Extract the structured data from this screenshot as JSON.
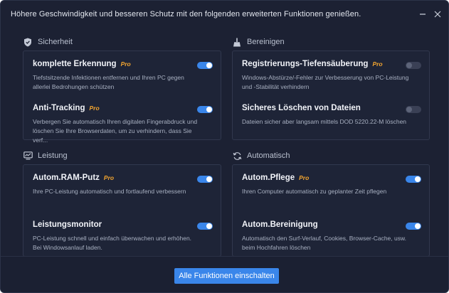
{
  "window": {
    "title": "Höhere Geschwindigkeit und besseren Schutz mit den folgenden erweiterten Funktionen genießen."
  },
  "colors": {
    "accent": "#3a86ea",
    "pro": "#f3a52f",
    "background": "#1c2133"
  },
  "sections": [
    {
      "title": "Sicherheit",
      "icon": "shield-icon",
      "items": [
        {
          "name": "komplette Erkennung",
          "pro": "Pro",
          "enabled": true,
          "description": "Tiefstsitzende Infektionen entfernen und Ihren PC gegen allerlei Bedrohungen schützen"
        },
        {
          "name": "Anti-Tracking",
          "pro": "Pro",
          "enabled": true,
          "description": "Verbergen Sie automatisch Ihren digitalen Fingerabdruck und löschen Sie Ihre Browserdaten, um zu verhindern, dass Sie verf..."
        }
      ]
    },
    {
      "title": "Bereinigen",
      "icon": "broom-icon",
      "items": [
        {
          "name": "Registrierungs-Tiefensäuberung",
          "pro": "Pro",
          "enabled": false,
          "description": "Windows-Abstürze/-Fehler zur Verbesserung von PC-Leistung und -Stabilität verhindern"
        },
        {
          "name": "Sicheres Löschen von Dateien",
          "pro": "",
          "enabled": false,
          "description": "Dateien sicher aber langsam mittels DOD 5220.22-M löschen"
        }
      ]
    },
    {
      "title": "Leistung",
      "icon": "monitor-icon",
      "items": [
        {
          "name": "Autom.RAM-Putz",
          "pro": "Pro",
          "enabled": true,
          "description": "Ihre PC-Leistung automatisch und fortlaufend verbessern"
        },
        {
          "name": "Leistungsmonitor",
          "pro": "",
          "enabled": true,
          "description": "PC-Leistung schnell und einfach überwachen und erhöhen. Bei Windowsanlauf laden."
        }
      ]
    },
    {
      "title": "Automatisch",
      "icon": "refresh-icon",
      "items": [
        {
          "name": "Autom.Pflege",
          "pro": "Pro",
          "enabled": true,
          "description": "Ihren Computer automatisch zu geplanter Zeit pflegen"
        },
        {
          "name": "Autom.Bereinigung",
          "pro": "",
          "enabled": true,
          "description": "Automatisch den Surf-Verlauf, Cookies, Browser-Cache, usw. beim Hochfahren löschen"
        }
      ]
    }
  ],
  "footer": {
    "button_label": "Alle Funktionen einschalten"
  }
}
